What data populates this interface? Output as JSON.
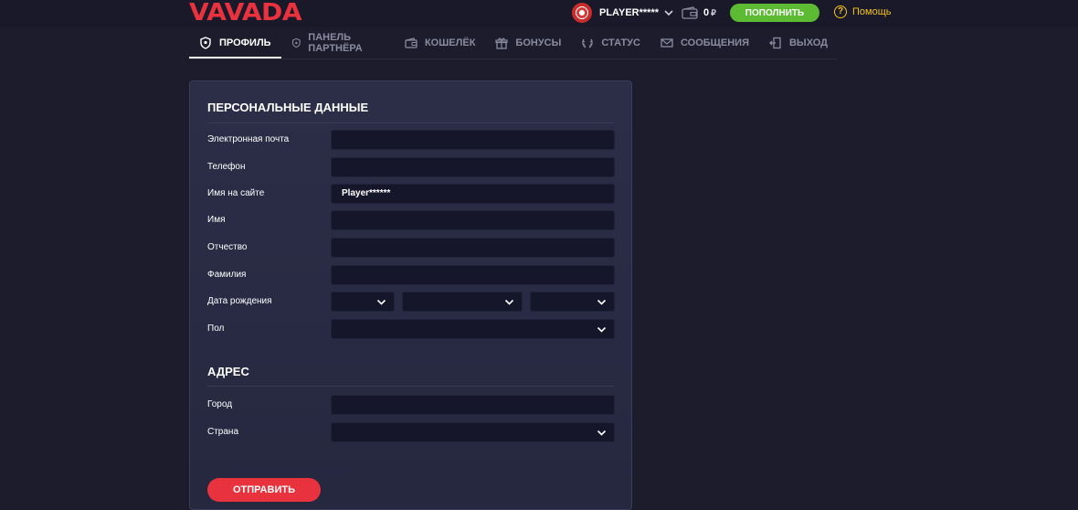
{
  "header": {
    "logo": "VAVADA",
    "username": "PLAYER*****",
    "balance": "0",
    "currency_symbol": "₽",
    "deposit_label": "ПОПОЛНИТЬ",
    "help_label": "Помощь",
    "help_glyph": "?",
    "colors": {
      "brand": "#e8323e",
      "deposit": "#5dbb33",
      "help": "#f5c518"
    }
  },
  "tabs": [
    {
      "label": "ПРОФИЛЬ",
      "icon": "shield-icon",
      "active": true
    },
    {
      "label": "ПАНЕЛЬ ПАРТНЁРА",
      "icon": "partner-icon",
      "active": false
    },
    {
      "label": "КОШЕЛЁК",
      "icon": "wallet-icon",
      "active": false
    },
    {
      "label": "БОНУСЫ",
      "icon": "gift-icon",
      "active": false
    },
    {
      "label": "СТАТУС",
      "icon": "laurel-icon",
      "active": false
    },
    {
      "label": "СООБЩЕНИЯ",
      "icon": "envelope-icon",
      "active": false
    },
    {
      "label": "ВЫХОД",
      "icon": "exit-icon",
      "active": false
    }
  ],
  "personal": {
    "title": "ПЕРСОНАЛЬНЫЕ ДАННЫЕ",
    "email_label": "Электронная почта",
    "email_value": "",
    "phone_label": "Телефон",
    "phone_value": "",
    "nickname_label": "Имя на сайте",
    "nickname_value": "Player******",
    "first_name_label": "Имя",
    "first_name_value": "",
    "middle_name_label": "Отчество",
    "middle_name_value": "",
    "last_name_label": "Фамилия",
    "last_name_value": "",
    "birthdate_label": "Дата рождения",
    "birth_day": "",
    "birth_month": "",
    "birth_year": "",
    "gender_label": "Пол",
    "gender_value": ""
  },
  "address": {
    "title": "АДРЕС",
    "city_label": "Город",
    "city_value": "",
    "country_label": "Страна",
    "country_value": ""
  },
  "submit_label": "ОТПРАВИТЬ"
}
